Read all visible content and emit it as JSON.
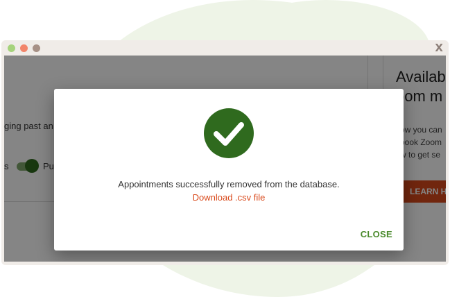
{
  "window": {
    "close_label": "X",
    "dots": [
      "#a6d37c",
      "#f2856a",
      "#a79186"
    ]
  },
  "background": {
    "left_text_1": "ging past an",
    "left_text_2": "s",
    "left_text_3": "Pu",
    "right_heading_1": "Availabl",
    "right_heading_2": "oom m",
    "right_text_1": "ow you can",
    "right_text_2": "book Zoom",
    "right_text_3": "w to get se",
    "learn_button": "LEARN HO"
  },
  "modal": {
    "message": "Appointments successfully removed from the database.",
    "download_link": "Download .csv file",
    "close_button": "CLOSE",
    "status_icon": "check-circle-icon",
    "accent_color": "#2f6a1e",
    "link_color": "#d9491b"
  }
}
